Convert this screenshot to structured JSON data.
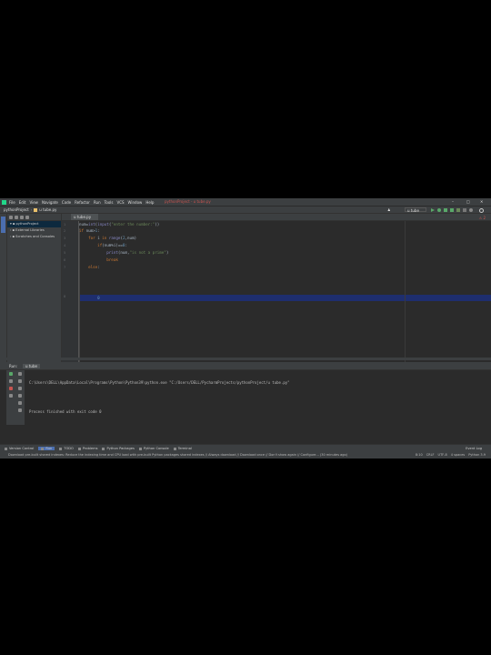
{
  "app": {
    "project_name": "pythonProject",
    "window_title": "pythonProject - u tube.py",
    "menu": [
      "File",
      "Edit",
      "View",
      "Navigate",
      "Code",
      "Refactor",
      "Run",
      "Tools",
      "VCS",
      "Window",
      "Help"
    ]
  },
  "navbar": {
    "breadcrumb_project": "pythonProject",
    "breadcrumb_file": "u tube.py",
    "run_config": "u tube"
  },
  "project_panel": {
    "items": [
      "pythonProject",
      "External Libraries",
      "Scratches and Consoles"
    ]
  },
  "editor": {
    "tab_label": "u tube.py",
    "warning_count": "2",
    "line_numbers": [
      "1",
      "2",
      "3",
      "4",
      "5",
      "6",
      "7",
      "8"
    ]
  },
  "run_panel": {
    "label": "Run:",
    "tab": "u tube",
    "console_line1": "C:\\Users\\DELL\\AppData\\Local\\Programs\\Python\\Python39\\python.exe \"C:/Users/DELL/PycharmProjects/pythonProject/u tube.py\"",
    "console_line2": "Process finished with exit code 0"
  },
  "bottom_tabs": [
    "Version Control",
    "Run",
    "TODO",
    "Problems",
    "Python Packages",
    "Python Console",
    "Terminal"
  ],
  "event_log": "Event Log",
  "status": {
    "message": "Download pre-built shared indexes: Reduce the indexing time and CPU load with pre-built Python packages shared indexes // Always download // Download once // Don't show again // Configure... (30 minutes ago)",
    "position": "8:10",
    "line_sep": "CRLF",
    "encoding": "UTF-8",
    "indent": "4 spaces",
    "interpreter": "Python 3.9"
  },
  "colors": {
    "accent": "#4b6eaf",
    "keyword": "#cc7832",
    "string": "#6a8759",
    "number": "#6897bb"
  }
}
